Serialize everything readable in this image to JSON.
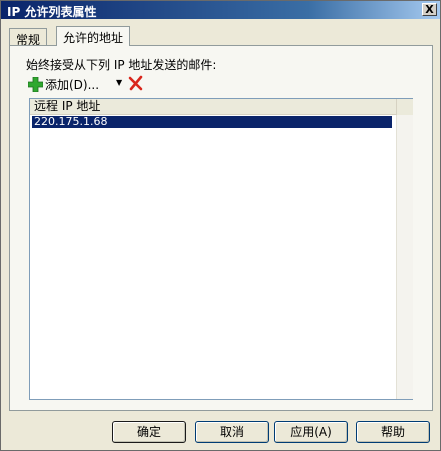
{
  "window": {
    "title": "IP 允许列表属性",
    "close_label": "X"
  },
  "tabs": [
    {
      "label": "常规",
      "active": false
    },
    {
      "label": "允许的地址",
      "active": true
    }
  ],
  "panel": {
    "description": "始终接受从下列 IP 地址发送的邮件:",
    "add_label": "添加(D)...",
    "dropdown_arrow": "▼",
    "list_header": "远程 IP 地址",
    "rows": [
      "220.175.1.68"
    ]
  },
  "buttons": {
    "ok": "确定",
    "cancel": "取消",
    "apply": "应用(A)",
    "help": "帮助"
  },
  "colors": {
    "title_bar": "#0a246a",
    "selection": "#0a246a",
    "add_icon": "#2fa82f",
    "delete_icon": "#d9261c"
  }
}
